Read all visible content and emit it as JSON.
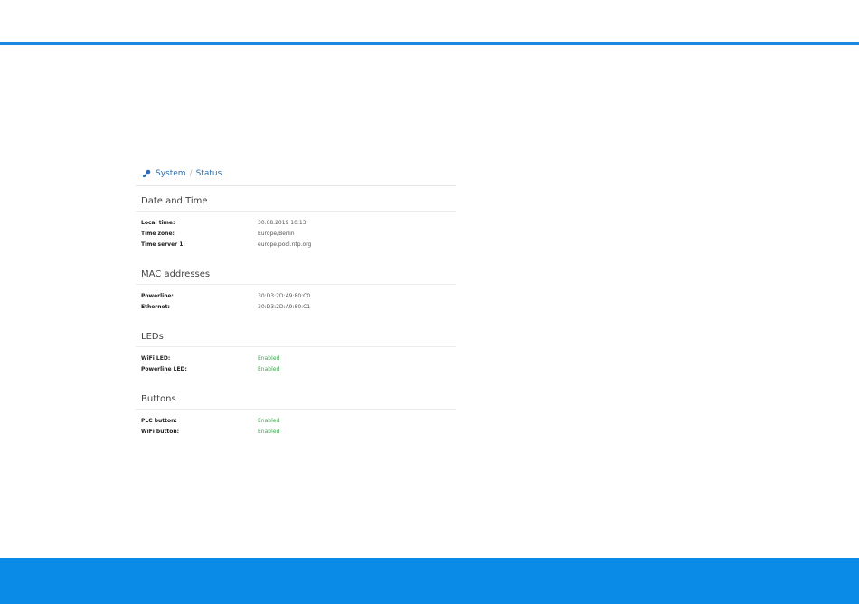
{
  "breadcrumb": {
    "root": "System",
    "separator": "/",
    "current": "Status",
    "icon": "network-icon"
  },
  "colors": {
    "accent": "#0a8be8",
    "link": "#2a6fb0",
    "enabled": "#3aa84a"
  },
  "sections": {
    "datetime": {
      "title": "Date and Time",
      "rows": [
        {
          "label": "Local time:",
          "value": "30.08.2019 10:13"
        },
        {
          "label": "Time zone:",
          "value": "Europe/Berlin"
        },
        {
          "label": "Time server 1:",
          "value": "europe.pool.ntp.org"
        }
      ]
    },
    "mac": {
      "title": "MAC addresses",
      "rows": [
        {
          "label": "Powerline:",
          "value": "30:D3:2D:A9:80:C0"
        },
        {
          "label": "Ethernet:",
          "value": "30:D3:2D:A9:80:C1"
        }
      ]
    },
    "leds": {
      "title": "LEDs",
      "rows": [
        {
          "label": "WiFi LED:",
          "value": "Enabled"
        },
        {
          "label": "Powerline LED:",
          "value": "Enabled"
        }
      ]
    },
    "buttons": {
      "title": "Buttons",
      "rows": [
        {
          "label": "PLC button:",
          "value": "Enabled"
        },
        {
          "label": "WiFi button:",
          "value": "Enabled"
        }
      ]
    }
  }
}
